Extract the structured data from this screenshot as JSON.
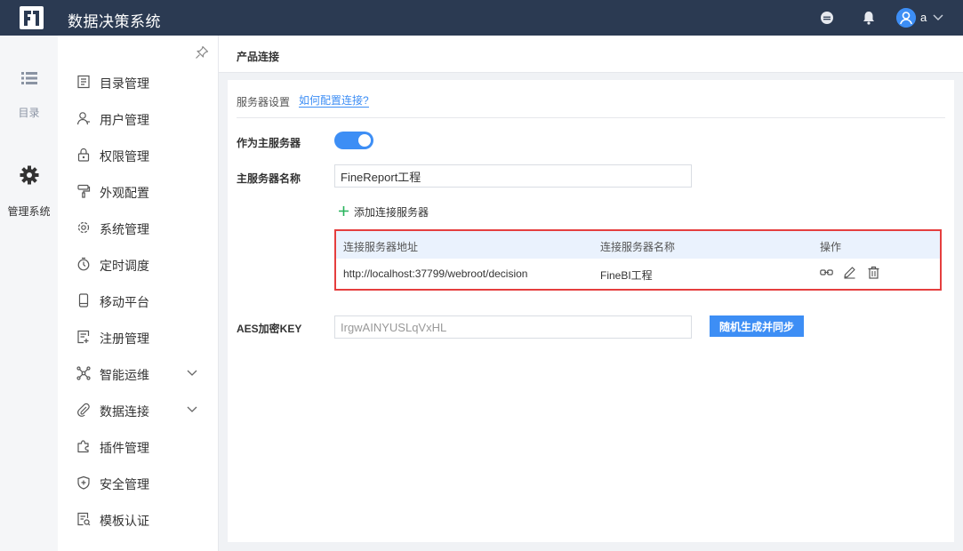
{
  "header": {
    "app_title": "数据决策系统",
    "user_name": "a"
  },
  "rail": {
    "items": [
      {
        "label": "目录",
        "icon": "list-icon"
      },
      {
        "label": "管理系统",
        "icon": "gear-icon"
      }
    ]
  },
  "sidebar": {
    "items": [
      {
        "label": "目录管理",
        "icon": "catalog-icon"
      },
      {
        "label": "用户管理",
        "icon": "user-icon"
      },
      {
        "label": "权限管理",
        "icon": "lock-icon"
      },
      {
        "label": "外观配置",
        "icon": "paint-roller-icon"
      },
      {
        "label": "系统管理",
        "icon": "settings-icon"
      },
      {
        "label": "定时调度",
        "icon": "stopwatch-icon"
      },
      {
        "label": "移动平台",
        "icon": "mobile-icon"
      },
      {
        "label": "注册管理",
        "icon": "register-icon"
      },
      {
        "label": "智能运维",
        "icon": "network-icon",
        "expandable": true
      },
      {
        "label": "数据连接",
        "icon": "paperclip-icon",
        "expandable": true
      },
      {
        "label": "插件管理",
        "icon": "puzzle-icon"
      },
      {
        "label": "安全管理",
        "icon": "shield-icon"
      },
      {
        "label": "模板认证",
        "icon": "template-icon"
      }
    ]
  },
  "main": {
    "page_title": "产品连接",
    "section_label": "服务器设置",
    "help_link": "如何配置连接?",
    "master_label": "作为主服务器",
    "master_enabled": true,
    "master_name_label": "主服务器名称",
    "master_name_value": "FineReport工程",
    "add_server_label": "添加连接服务器",
    "table": {
      "columns": [
        "连接服务器地址",
        "连接服务器名称",
        "操作"
      ],
      "rows": [
        {
          "address": "http://localhost:37799/webroot/decision",
          "name": "FineBI工程"
        }
      ]
    },
    "aes_label": "AES加密KEY",
    "aes_value": "IrgwAINYUSLqVxHL",
    "aes_button": "随机生成并同步"
  },
  "colors": {
    "topbar": "#2b3a52",
    "accent": "#3d8ef5",
    "highlight_border": "#e53e3e",
    "add_icon": "#27b35b"
  }
}
